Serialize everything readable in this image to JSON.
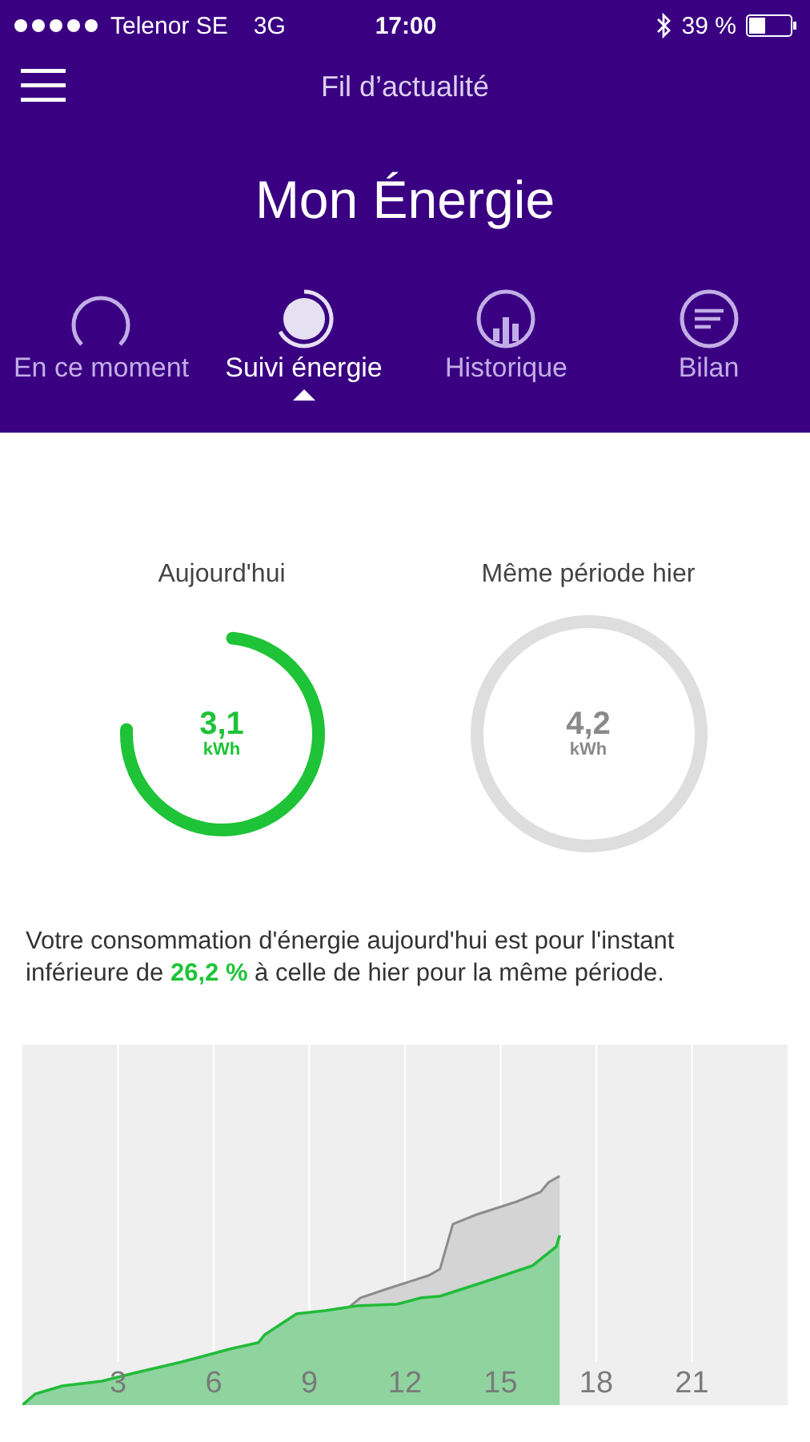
{
  "status_bar": {
    "carrier": "Telenor SE",
    "network": "3G",
    "time": "17:00",
    "battery": "39 %"
  },
  "nav": {
    "title": "Fil d’actualité"
  },
  "header": {
    "title": "Mon Énergie"
  },
  "tabs": [
    {
      "label": "En ce moment",
      "selected": false
    },
    {
      "label": "Suivi énergie",
      "selected": true
    },
    {
      "label": "Historique",
      "selected": false
    },
    {
      "label": "Bilan",
      "selected": false
    }
  ],
  "gauges": [
    {
      "label": "Aujourd'hui",
      "value": "3,1",
      "unit": "kWh",
      "level": 0.74,
      "color": "#1ec337"
    },
    {
      "label": "Même période hier",
      "value": "4,2",
      "unit": "kWh",
      "level": 1,
      "color": "#dedede"
    }
  ],
  "summary": "Votre consommation d'énergie aujourd'hui est pour l'instant inférieure de **26,2 %** à celle de hier pour la même période.",
  "chart": {
    "x_labels": [
      "3",
      "6",
      "9",
      "12",
      "15",
      "18",
      "21"
    ]
  }
}
